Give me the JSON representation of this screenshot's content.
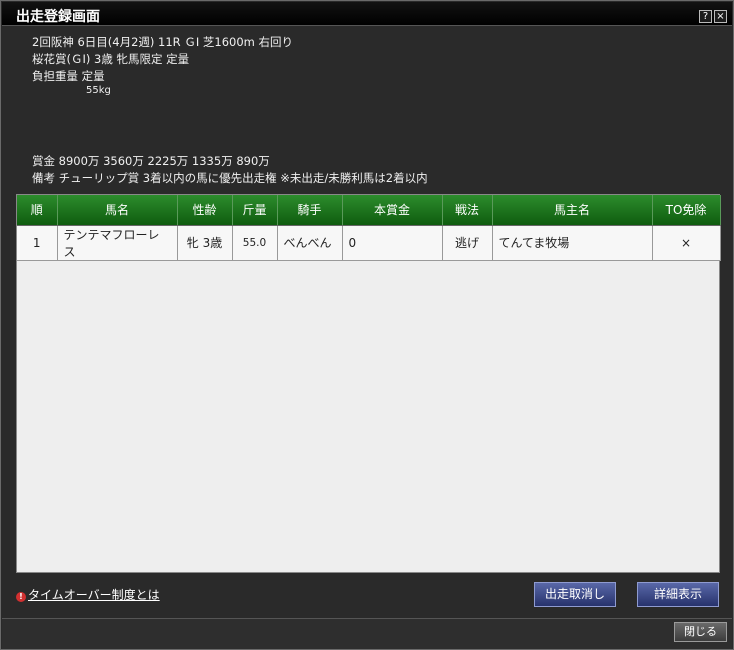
{
  "window": {
    "title": "出走登録画面",
    "help_label": "?",
    "close_label": "×"
  },
  "race": {
    "line1": "2回阪神 6日目(4月2週) 11R ＧⅠ 芝1600m 右回り",
    "line2": "桜花賞(ＧⅠ) 3歳 牝馬限定 定量",
    "line3": "負担重量 定量",
    "line4": "55kg",
    "prize": "賞金 8900万 3560万 2225万 1335万 890万",
    "note": "備考 チューリップ賞 3着以内の馬に優先出走権 ※未出走/未勝利馬は2着以内"
  },
  "table": {
    "headers": [
      "順",
      "馬名",
      "性齢",
      "斤量",
      "騎手",
      "本賞金",
      "戦法",
      "馬主名",
      "TO免除"
    ],
    "rows": [
      [
        "1",
        "テンテマフローレス",
        "牝 3歳",
        "55.0",
        "べんべん",
        "0",
        "逃げ",
        "てんてま牧場",
        "×"
      ]
    ]
  },
  "help_link": {
    "mark": "!",
    "label": "タイムオーバー制度とは"
  },
  "buttons": {
    "cancel_entry": "出走取消し",
    "details": "詳細表示",
    "close": "閉じる"
  }
}
